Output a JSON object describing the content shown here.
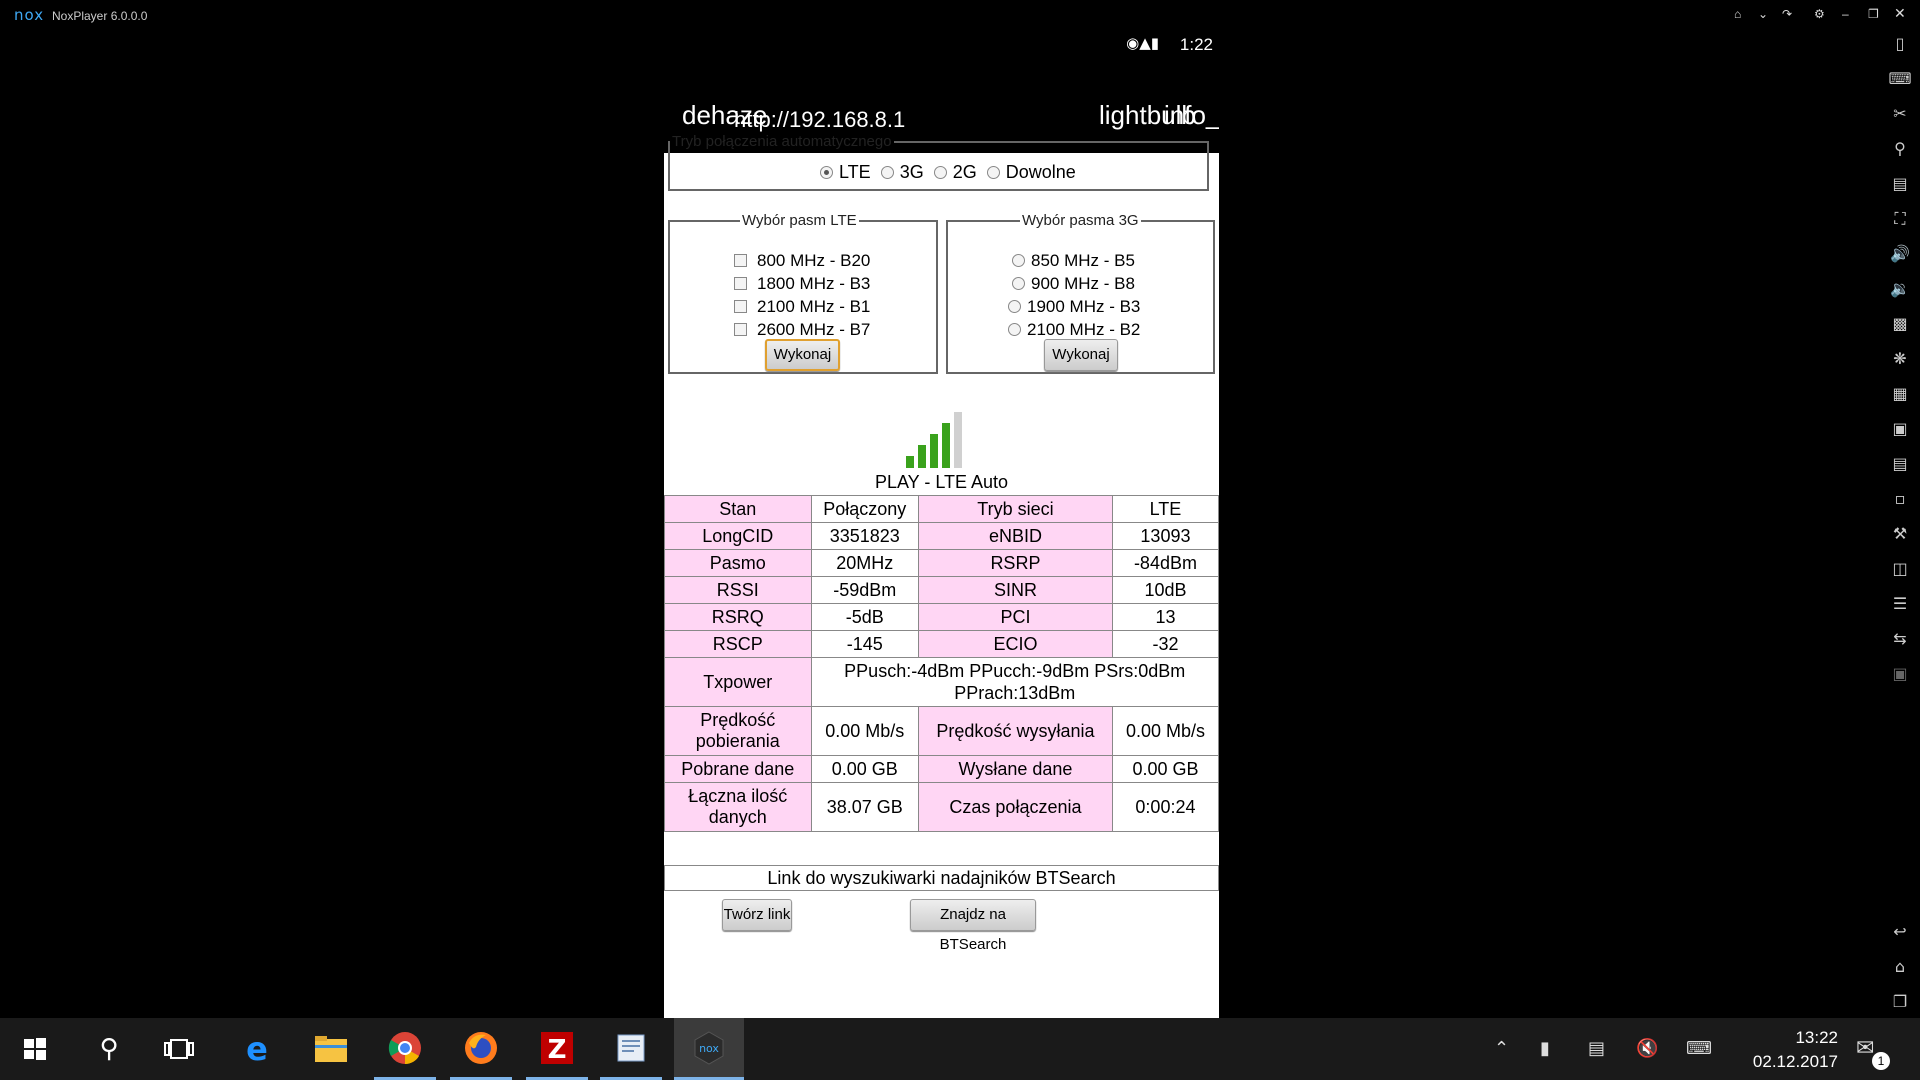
{
  "window": {
    "logo": "nox",
    "title": "NoxPlayer 6.0.0.0"
  },
  "status_bar": {
    "time": "1:22"
  },
  "app_bar": {
    "left_a": "dehaze",
    "left_b": "http://192.168.8.1",
    "right_a": "lightbulb",
    "right_b": "info_"
  },
  "mode": {
    "legend": "Tryb połączenia automatycznego",
    "options": [
      "LTE",
      "3G",
      "2G",
      "Dowolne"
    ],
    "selected": "LTE"
  },
  "lte_bands": {
    "legend": "Wybór pasm LTE",
    "options": [
      "800 MHz - B20",
      "1800 MHz - B3",
      "2100 MHz - B1",
      "2600 MHz - B7"
    ],
    "button": "Wykonaj"
  },
  "bands_3g": {
    "legend": "Wybór pasma 3G",
    "options": [
      "850 MHz - B5",
      "900 MHz - B8",
      "1900 MHz - B3",
      "2100 MHz - B2"
    ],
    "button": "Wykonaj"
  },
  "signal": {
    "operator": "PLAY - LTE Auto",
    "bars_active": 4,
    "bars_total": 5,
    "active_color": "#3aa21c",
    "inactive_color": "#d0d0d0"
  },
  "info": {
    "rows": [
      [
        "Stan",
        "Połączony",
        "Tryb sieci",
        "LTE"
      ],
      [
        "LongCID",
        "3351823",
        "eNBID",
        "13093"
      ],
      [
        "Pasmo",
        "20MHz",
        "RSRP",
        "-84dBm"
      ],
      [
        "RSSI",
        "-59dBm",
        "SINR",
        "10dB"
      ],
      [
        "RSRQ",
        "-5dB",
        "PCI",
        "13"
      ],
      [
        "RSCP",
        "-145",
        "ECIO",
        "-32"
      ]
    ],
    "txpower_label": "Txpower",
    "txpower_value": "PPusch:-4dBm PPucch:-9dBm PSrs:0dBm PPrach:13dBm",
    "speed": [
      "Prędkość pobierania",
      "0.00 Mb/s",
      "Prędkość wysyłania",
      "0.00 Mb/s"
    ],
    "data": [
      "Pobrane dane",
      "0.00 GB",
      "Wysłane dane",
      "0.00 GB"
    ],
    "total": [
      "Łączna ilość danych",
      "38.07 GB",
      "Czas połączenia",
      "0:00:24"
    ]
  },
  "link": {
    "text": "Link do wyszukiwarki nadajników BTSearch",
    "create_button": "Twórz link",
    "find_button": "Znajdz na BTSearch"
  },
  "taskbar": {
    "time": "13:22",
    "date": "02.12.2017",
    "notification_count": "1"
  }
}
